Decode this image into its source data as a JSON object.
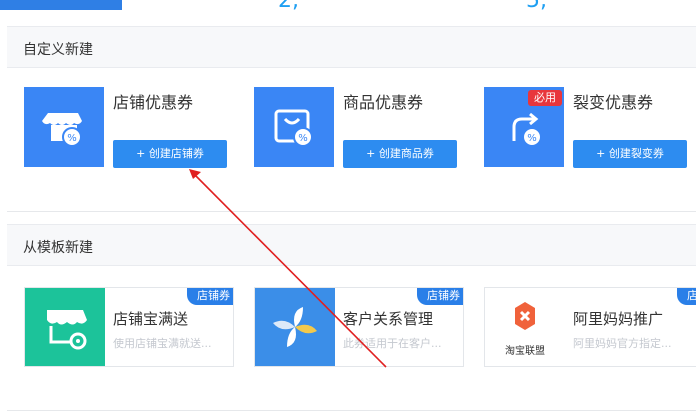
{
  "top_stats": [
    {
      "label": "",
      "value": "2,"
    },
    {
      "label": "",
      "value": "5,"
    }
  ],
  "sections": {
    "custom": {
      "title": "自定义新建"
    },
    "template": {
      "title": "从模板新建"
    }
  },
  "custom_cards": [
    {
      "title": "店铺优惠券",
      "button": "+ 创建店铺券",
      "icon": "shop-coupon-icon",
      "badge": ""
    },
    {
      "title": "商品优惠券",
      "button": "+ 创建商品券",
      "icon": "bag-coupon-icon",
      "badge": ""
    },
    {
      "title": "裂变优惠券",
      "button": "+ 创建裂变券",
      "icon": "share-coupon-icon",
      "badge": "必用"
    }
  ],
  "template_cards": [
    {
      "name": "店铺宝满送",
      "desc": "使用店铺宝满就送...",
      "tag": "店铺券",
      "icon": "store-gear-icon",
      "tile_color": "#1cc39a"
    },
    {
      "name": "客户关系管理",
      "desc": "此券适用于在客户...",
      "tag": "店铺券",
      "icon": "pinwheel-icon",
      "tile_color": "#3b8ee8"
    },
    {
      "name": "阿里妈妈推广",
      "desc": "阿里妈妈官方指定...",
      "tag": "店铺券",
      "icon": "taobao-union-logo",
      "tile_color": "#ffffff",
      "logo_text": "淘宝联盟"
    }
  ],
  "colors": {
    "accent": "#2d8cf0",
    "tile_blue": "#3a86f5",
    "badge_red": "#e8363c",
    "arrow_red": "#e02020"
  }
}
